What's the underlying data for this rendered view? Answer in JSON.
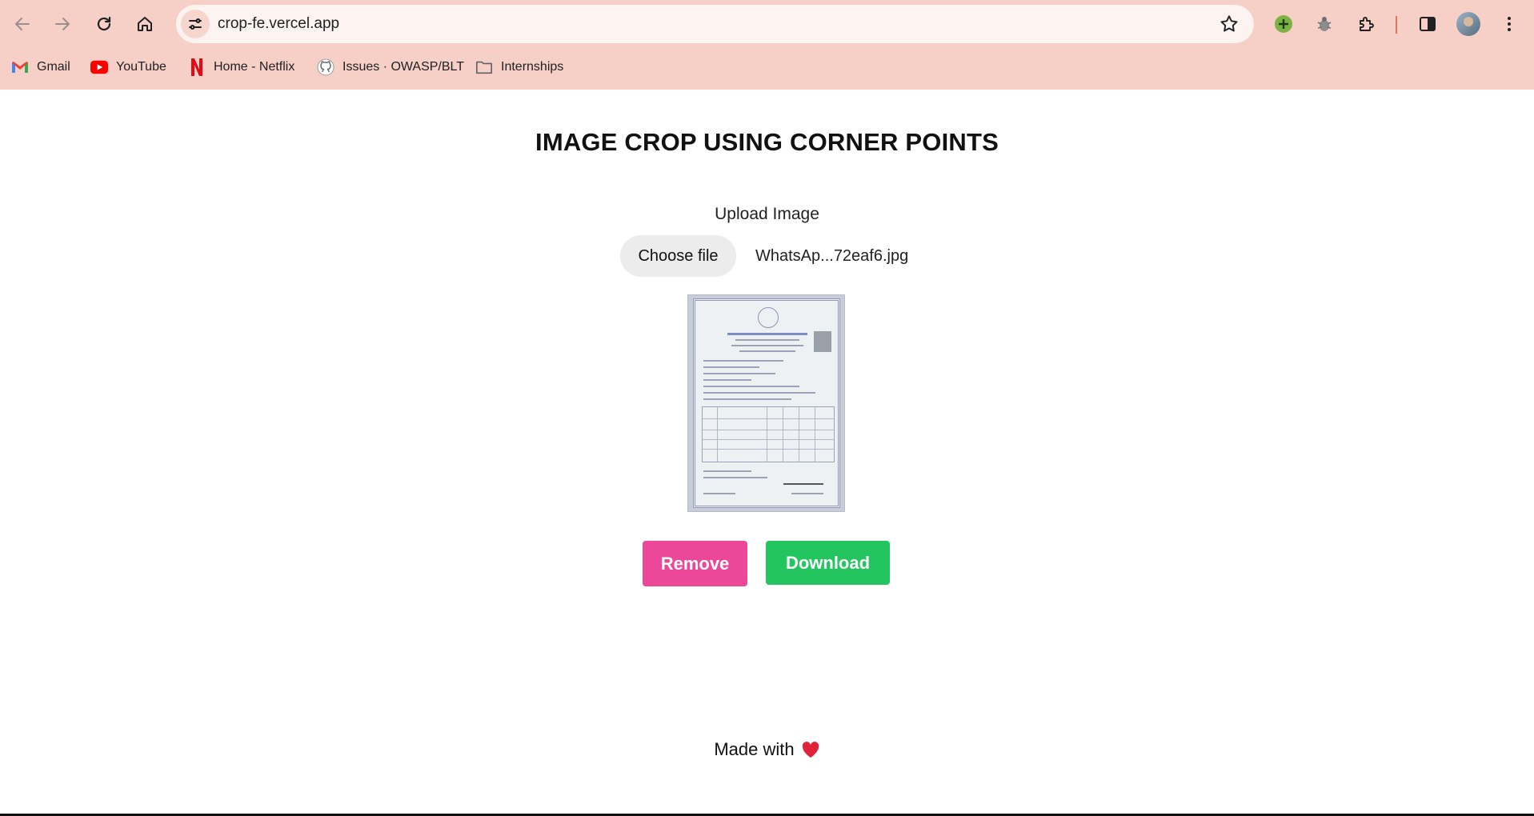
{
  "browser": {
    "url": "crop-fe.vercel.app",
    "bookmarks": [
      {
        "label": "Gmail",
        "icon": "gmail-icon"
      },
      {
        "label": "YouTube",
        "icon": "youtube-icon"
      },
      {
        "label": "Home - Netflix",
        "icon": "netflix-icon"
      },
      {
        "label": "Issues · OWASP/BLT",
        "icon": "github-icon"
      },
      {
        "label": "Internships",
        "icon": "folder-icon"
      }
    ],
    "colors": {
      "toolbar": "#f6d0c6",
      "omnibox": "#fdf3f0"
    }
  },
  "page": {
    "title": "IMAGE CROP USING CORNER POINTS",
    "upload_label": "Upload Image",
    "choose_file_label": "Choose file",
    "file_name": "WhatsAp...72eaf6.jpg",
    "remove_label": "Remove",
    "download_label": "Download",
    "footer_text": "Made with",
    "footer_icon": "heart-icon",
    "colors": {
      "remove": "#ec4899",
      "download": "#22c55e"
    }
  }
}
